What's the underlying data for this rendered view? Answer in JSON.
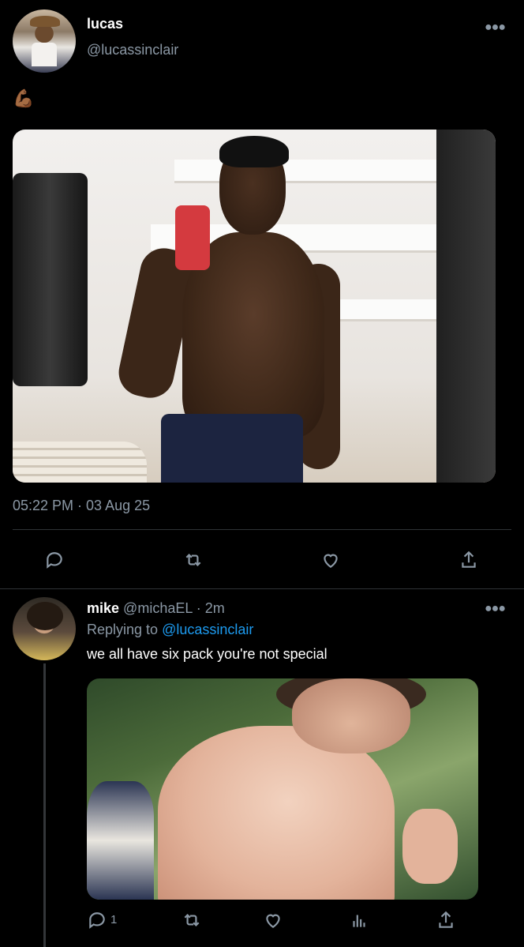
{
  "main_tweet": {
    "display_name": "lucas",
    "handle": "@lucassinclair",
    "text": "💪🏾",
    "timestamp": "05:22 PM · 03 Aug 25",
    "more_icon": "more-dots-icon",
    "actions": [
      "reply-icon",
      "retweet-icon",
      "like-icon",
      "share-icon"
    ]
  },
  "reply": {
    "display_name": "mike",
    "handle": "@michaEL",
    "separator": "·",
    "time": "2m",
    "replying_prefix": "Replying to",
    "replying_to": "@lucassinclair",
    "text": "we all have six pack you're not special",
    "reply_count": "1",
    "more_icon": "more-dots-icon",
    "actions": [
      "reply-icon",
      "retweet-icon",
      "like-icon",
      "analytics-icon",
      "share-icon"
    ]
  },
  "colors": {
    "background": "#000000",
    "muted": "#8b98a5",
    "link": "#1d9bf0",
    "divider": "#2f3336"
  }
}
